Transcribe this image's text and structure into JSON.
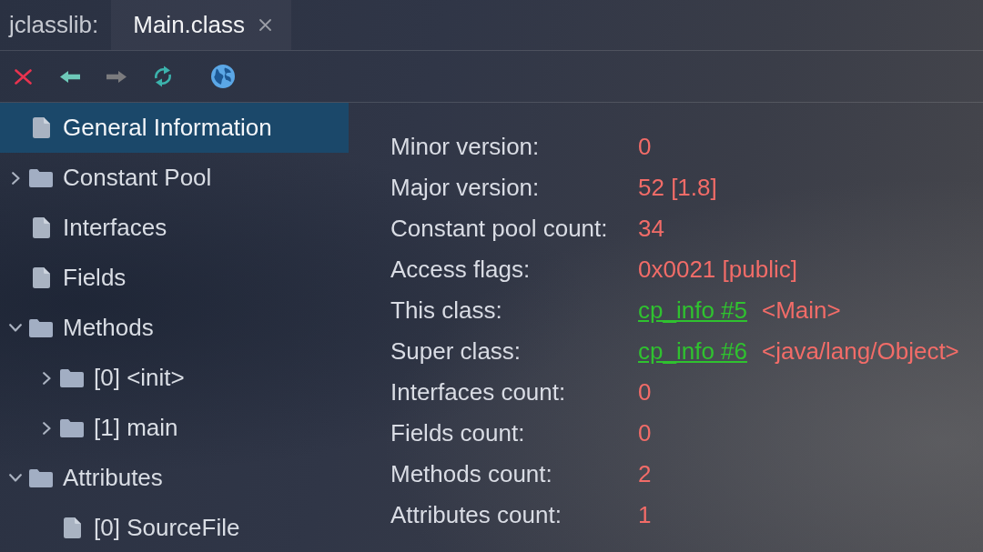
{
  "window": {
    "app_label": "jclasslib:"
  },
  "tabs": [
    {
      "label": "Main.class",
      "selected": true
    }
  ],
  "toolbar": [
    {
      "kind": "close",
      "disabled": false
    },
    {
      "kind": "back",
      "disabled": false
    },
    {
      "kind": "forward",
      "disabled": true
    },
    {
      "kind": "reload",
      "disabled": false
    },
    {
      "kind": "browser",
      "disabled": false
    }
  ],
  "tree": [
    {
      "kind": "file",
      "label": "General Information",
      "selected": true
    },
    {
      "kind": "folder",
      "label": "Constant Pool",
      "selected": false,
      "expanded": false
    },
    {
      "kind": "file",
      "label": "Interfaces",
      "selected": false
    },
    {
      "kind": "file",
      "label": "Fields",
      "selected": false
    },
    {
      "kind": "folder",
      "label": "Methods",
      "selected": false,
      "expanded": true,
      "children": [
        {
          "kind": "folder",
          "label": "[0] <init>",
          "selected": false,
          "expanded": false
        },
        {
          "kind": "folder",
          "label": "[1] main",
          "selected": false,
          "expanded": false
        }
      ]
    },
    {
      "kind": "folder",
      "label": "Attributes",
      "selected": false,
      "expanded": true,
      "children": [
        {
          "kind": "file",
          "label": "[0] SourceFile",
          "selected": false
        }
      ]
    }
  ],
  "details": [
    {
      "kind": "plain",
      "label": "Minor version:",
      "value": "0"
    },
    {
      "kind": "plain",
      "label": "Major version:",
      "value": "52 [1.8]"
    },
    {
      "kind": "plain",
      "label": "Constant pool count:",
      "value": "34"
    },
    {
      "kind": "plain",
      "label": "Access flags:",
      "value": "0x0021 [public]"
    },
    {
      "kind": "reference",
      "label": "This class:",
      "link": "cp_info #5",
      "value": "<Main>"
    },
    {
      "kind": "reference",
      "label": "Super class:",
      "link": "cp_info #6",
      "value": "<java/lang/Object>"
    },
    {
      "kind": "plain",
      "label": "Interfaces count:",
      "value": "0"
    },
    {
      "kind": "plain",
      "label": "Fields count:",
      "value": "0"
    },
    {
      "kind": "plain",
      "label": "Methods count:",
      "value": "2"
    },
    {
      "kind": "plain",
      "label": "Attributes count:",
      "value": "1"
    }
  ]
}
